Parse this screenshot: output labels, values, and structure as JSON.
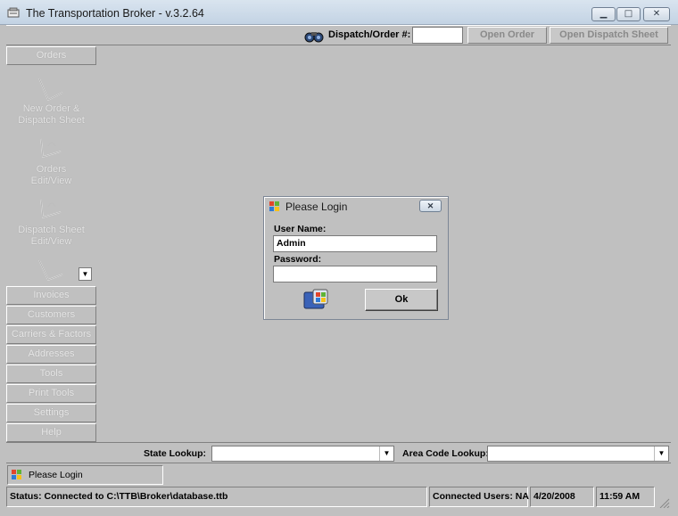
{
  "window": {
    "title": "The Transportation Broker - v.3.2.64"
  },
  "toolbar": {
    "dispatch_label": "Dispatch/Order #:",
    "dispatch_value": "",
    "open_order_label": "Open Order",
    "open_dispatch_label": "Open Dispatch Sheet"
  },
  "sidebar": {
    "orders_header": "Orders",
    "items": [
      {
        "line1": "New Order &",
        "line2": "Dispatch Sheet"
      },
      {
        "line1": "Orders",
        "line2": "Edit/View"
      },
      {
        "line1": "Dispatch Sheet",
        "line2": "Edit/View"
      }
    ],
    "sections": [
      "Invoices",
      "Customers",
      "Carriers & Factors",
      "Addresses",
      "Tools",
      "Print Tools",
      "Settings",
      "Help"
    ]
  },
  "login": {
    "title": "Please Login",
    "user_label": "User Name:",
    "user_value": "Admin",
    "pass_label": "Password:",
    "pass_value": "",
    "ok_label": "Ok"
  },
  "lookup": {
    "state_label": "State Lookup:",
    "state_value": "",
    "area_label": "Area Code Lookup:",
    "area_value": ""
  },
  "message": {
    "text": "Please Login"
  },
  "status": {
    "main": "Status: Connected to C:\\TTB\\Broker\\database.ttb",
    "users": "Connected Users: NA",
    "date": "4/20/2008",
    "time": "11:59 AM"
  }
}
